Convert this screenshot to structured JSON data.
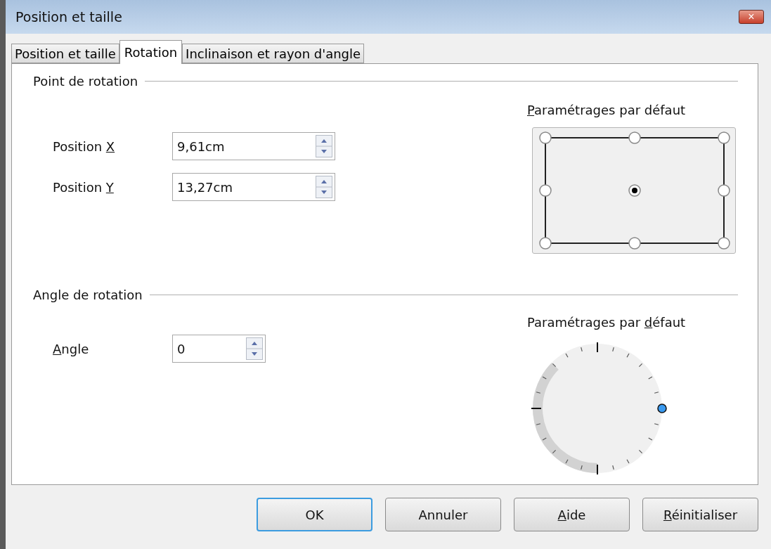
{
  "window": {
    "title": "Position et taille",
    "close": "×"
  },
  "tabs": [
    {
      "label": "Position et taille",
      "selected": false
    },
    {
      "label": "Rotation",
      "selected": true
    },
    {
      "label": "Inclinaison et rayon d'angle",
      "selected": false
    }
  ],
  "pivot": {
    "heading": "Point de rotation",
    "fields": [
      {
        "label": {
          "pre": "Position ",
          "key": "X"
        },
        "value": "9,61cm"
      },
      {
        "label": {
          "pre": "Position ",
          "key": "Y"
        },
        "value": "13,27cm"
      }
    ],
    "defaults_label": {
      "key": "P",
      "post": "aramétrages par défaut"
    },
    "points": [
      {
        "selected": false
      },
      {
        "selected": false
      },
      {
        "selected": false
      },
      {
        "selected": false
      },
      {
        "selected": true
      },
      {
        "selected": false
      },
      {
        "selected": false
      },
      {
        "selected": false
      },
      {
        "selected": false
      }
    ]
  },
  "angle": {
    "heading": "Angle de rotation",
    "fields": [
      {
        "label": {
          "key": "A",
          "post": "ngle"
        },
        "value": "0"
      }
    ],
    "defaults_label": {
      "pre": "Paramétrages par ",
      "key": "d",
      "post": "éfaut"
    }
  },
  "buttons": [
    {
      "label": {
        "pre": "OK"
      },
      "default": true
    },
    {
      "label": {
        "pre": "Annuler"
      },
      "default": false
    },
    {
      "label": {
        "key": "A",
        "post": "ide"
      },
      "default": false
    },
    {
      "label": {
        "key": "R",
        "post": "éinitialiser"
      },
      "default": false
    }
  ]
}
